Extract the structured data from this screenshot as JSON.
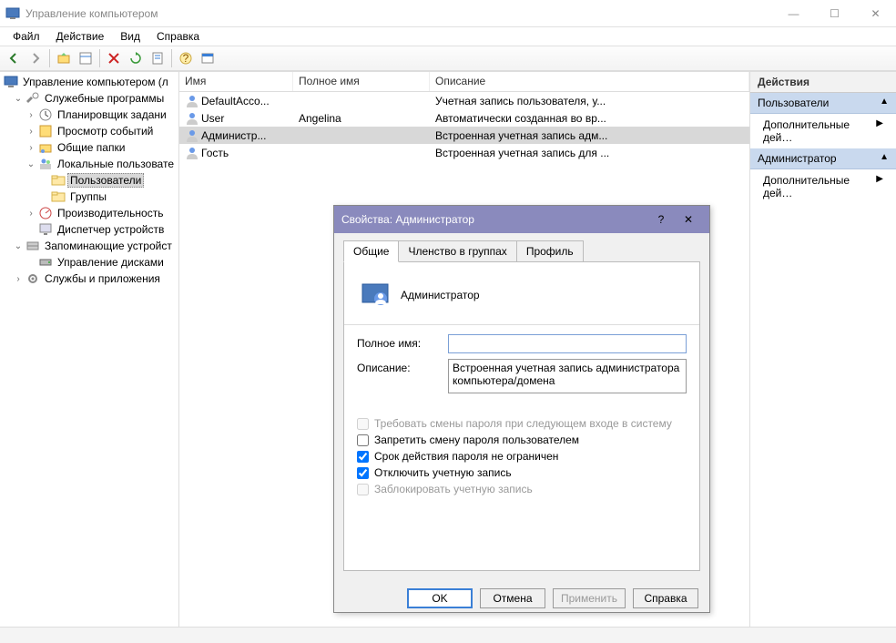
{
  "window": {
    "title": "Управление компьютером"
  },
  "menu": {
    "file": "Файл",
    "action": "Действие",
    "view": "Вид",
    "help": "Справка"
  },
  "tree": {
    "root": "Управление компьютером (л",
    "services_programs": "Служебные программы",
    "task_scheduler": "Планировщик задани",
    "event_viewer": "Просмотр событий",
    "shared_folders": "Общие папки",
    "local_users": "Локальные пользовате",
    "users": "Пользователи",
    "groups": "Группы",
    "performance": "Производительность",
    "device_manager": "Диспетчер устройств",
    "storage": "Запоминающие устройст",
    "disk_management": "Управление дисками",
    "services_apps": "Службы и приложения"
  },
  "list": {
    "columns": {
      "name": "Имя",
      "full_name": "Полное имя",
      "description": "Описание"
    },
    "rows": [
      {
        "name": "DefaultAcco...",
        "full_name": "",
        "description": "Учетная запись пользователя, у..."
      },
      {
        "name": "User",
        "full_name": "Angelina",
        "description": "Автоматически созданная во вр..."
      },
      {
        "name": "Администр...",
        "full_name": "",
        "description": "Встроенная учетная запись адм..."
      },
      {
        "name": "Гость",
        "full_name": "",
        "description": "Встроенная учетная запись для ..."
      }
    ]
  },
  "actions": {
    "title": "Действия",
    "group1": "Пользователи",
    "more1": "Дополнительные дей…",
    "group2": "Администратор",
    "more2": "Дополнительные дей…"
  },
  "dialog": {
    "title": "Свойства: Администратор",
    "tabs": {
      "general": "Общие",
      "membership": "Членство в группах",
      "profile": "Профиль"
    },
    "user_name": "Администратор",
    "full_name_label": "Полное имя:",
    "full_name_value": "",
    "description_label": "Описание:",
    "description_value": "Встроенная учетная запись администратора компьютера/домена",
    "chk_require_change": "Требовать смены пароля при следующем входе в систему",
    "chk_no_change": "Запретить смену пароля пользователем",
    "chk_never_expires": "Срок действия пароля не ограничен",
    "chk_disable": "Отключить учетную запись",
    "chk_lockout": "Заблокировать учетную запись",
    "ok": "OK",
    "cancel": "Отмена",
    "apply": "Применить",
    "help": "Справка"
  }
}
